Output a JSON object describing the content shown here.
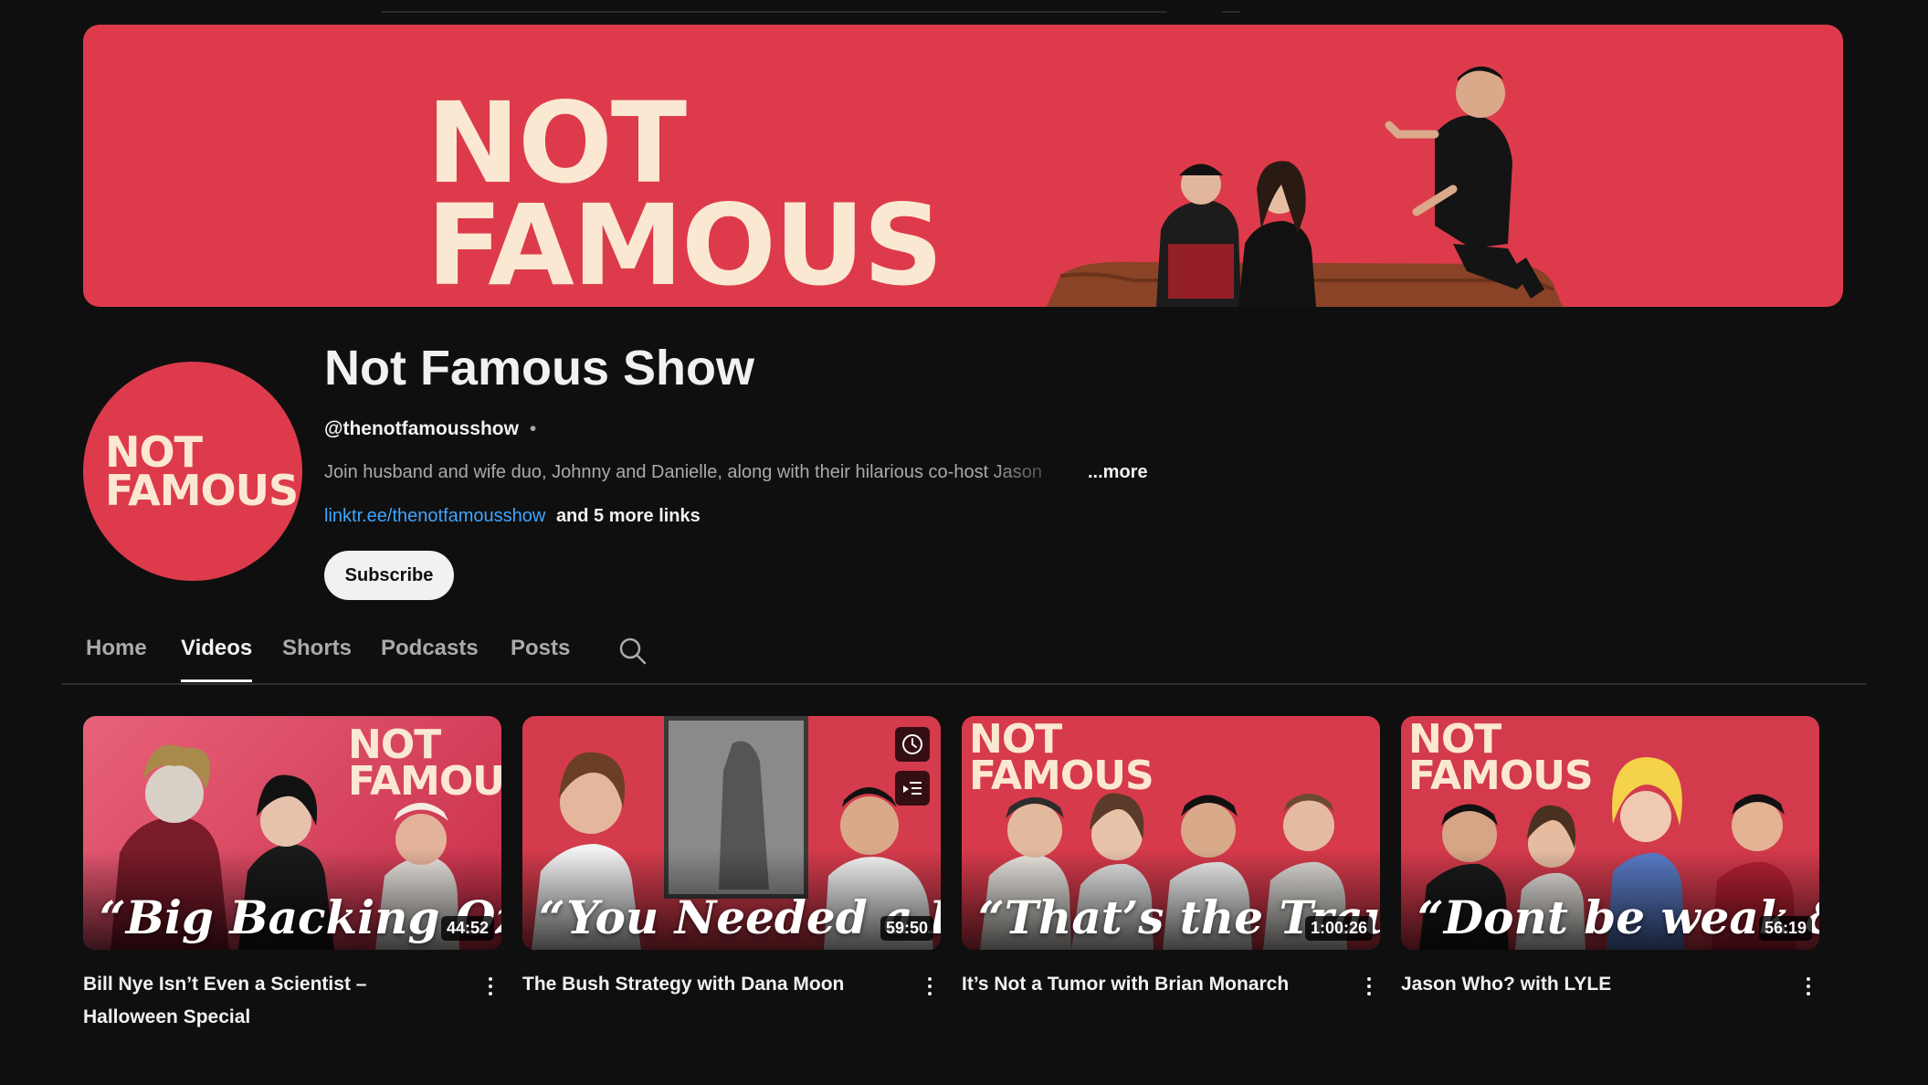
{
  "banner": {
    "logo_line1": "NOT",
    "logo_line2": "FAMOUS",
    "bg_color": "#dd3b4b",
    "logo_color": "#fbe8d3"
  },
  "avatar": {
    "logo_line1": "NOT",
    "logo_line2": "FAMOUS"
  },
  "channel": {
    "title": "Not Famous Show",
    "handle": "@thenotfamousshow",
    "separator": "•",
    "description": "Join husband and wife duo, Johnny and Danielle, along with their hilarious co-host Jason",
    "more_label": "...more",
    "link_text": "linktr.ee/thenotfamousshow",
    "more_links_label": "and 5 more links",
    "subscribe_label": "Subscribe"
  },
  "tabs": [
    {
      "label": "Home"
    },
    {
      "label": "Videos"
    },
    {
      "label": "Shorts"
    },
    {
      "label": "Podcasts"
    },
    {
      "label": "Posts"
    }
  ],
  "active_tab": "Videos",
  "videos": [
    {
      "title": "Bill Nye Isn’t Even a Scientist – Halloween Special",
      "duration": "44:52",
      "thumb_logo_line1": "NOT",
      "thumb_logo_line2": "FAMOUS",
      "thumb_script": "“Big Backing Ozempi"
    },
    {
      "title": "The Bush Strategy with Dana Moon",
      "duration": "59:50",
      "thumb_script": "“You Needed a Bush"
    },
    {
      "title": "It’s Not a Tumor with Brian Monarch",
      "duration": "1:00:26",
      "thumb_logo_line1": "NOT",
      "thumb_logo_line2": "FAMOUS",
      "thumb_script": "“That’s the Trauma?!”"
    },
    {
      "title": "Jason Who? with LYLE",
      "duration": "56:19",
      "thumb_logo_line1": "NOT",
      "thumb_logo_line2": "FAMOUS",
      "thumb_script": "“Dont be weak & gay"
    }
  ],
  "icons": {
    "search": "search-icon",
    "watch_later": "clock-icon",
    "add_to_queue": "queue-icon",
    "menu": "more-vert-icon"
  },
  "colors": {
    "background": "#0f0f0f",
    "link": "#3ea6ff",
    "brand_red": "#dd3b4b"
  }
}
